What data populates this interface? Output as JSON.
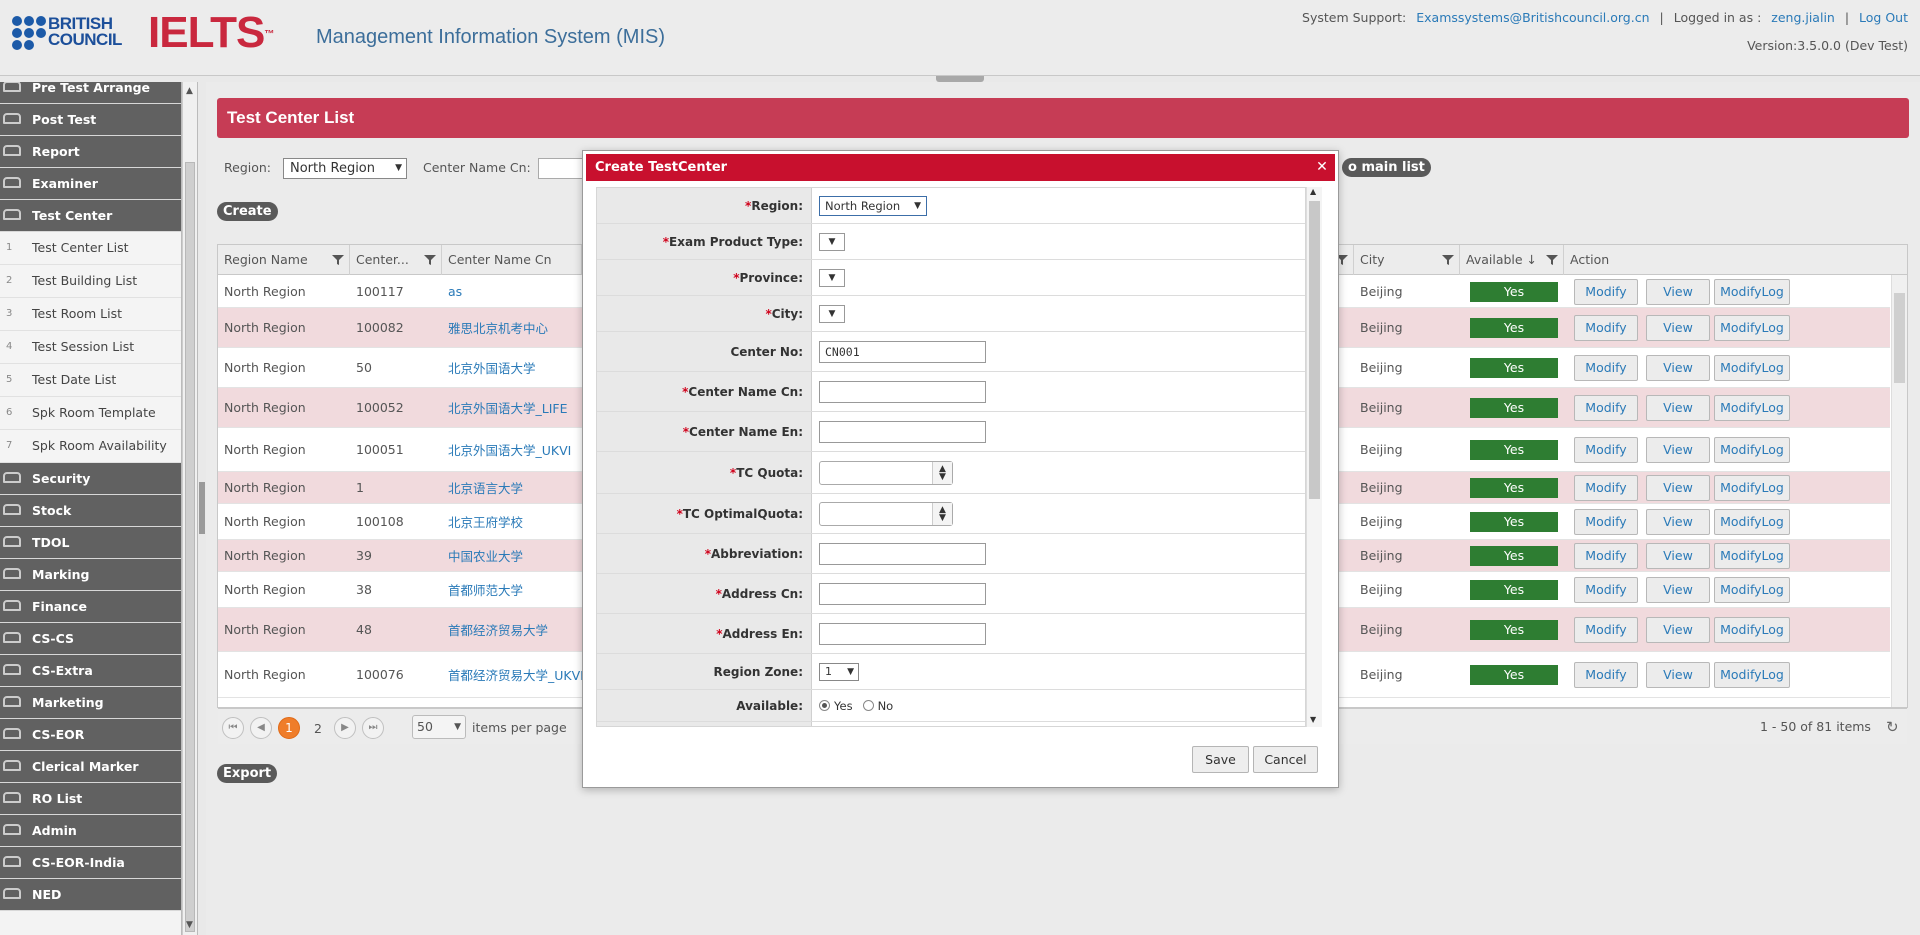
{
  "header": {
    "bc_text_line1": "BRITISH",
    "bc_text_line2": "COUNCIL",
    "ielts_logo": "IELTS",
    "app_title": "Management Information System (MIS)",
    "support_label": "System Support:",
    "support_email": "Examssystems@Britishcouncil.org.cn",
    "logged_label": "Logged in as :",
    "user": "zeng.jialin",
    "logout": "Log Out",
    "version": "Version:3.5.0.0 (Dev Test)"
  },
  "sidebar": {
    "top_items": [
      "Pre Test Arrange",
      "Post Test",
      "Report",
      "Examiner",
      "Test Center"
    ],
    "sub_items": [
      {
        "num": "1",
        "label": "Test Center List"
      },
      {
        "num": "2",
        "label": "Test Building List"
      },
      {
        "num": "3",
        "label": "Test Room List"
      },
      {
        "num": "4",
        "label": "Test Session List"
      },
      {
        "num": "5",
        "label": "Test Date List"
      },
      {
        "num": "6",
        "label": "Spk Room Template"
      },
      {
        "num": "7",
        "label": "Spk Room Availability"
      }
    ],
    "bottom_items": [
      "Security",
      "Stock",
      "TDOL",
      "Marking",
      "Finance",
      "CS-CS",
      "CS-Extra",
      "Marketing",
      "CS-EOR",
      "Clerical Marker",
      "RO List",
      "Admin",
      "CS-EOR-India",
      "NED"
    ]
  },
  "page": {
    "title": "Test Center List",
    "region_label": "Region:",
    "region_value": "North Region",
    "center_name_label": "Center Name Cn:",
    "main_list_btn": "o main list",
    "create_btn": "Create",
    "export_btn": "Export"
  },
  "grid": {
    "headers": {
      "region": "Region Name",
      "center": "Center...",
      "name_cn": "Center Name Cn",
      "city": "City",
      "available": "Available ↓",
      "action": "Action"
    },
    "rows": [
      {
        "region": "North Region",
        "center": "100117",
        "name": "as",
        "city": "Beijing",
        "available": "Yes"
      },
      {
        "region": "North Region",
        "center": "100082",
        "name": "雅思北京机考中心",
        "city": "Beijing",
        "available": "Yes"
      },
      {
        "region": "North Region",
        "center": "50",
        "name": "北京外国语大学",
        "city": "Beijing",
        "available": "Yes"
      },
      {
        "region": "North Region",
        "center": "100052",
        "name": "北京外国语大学_LIFE",
        "city": "Beijing",
        "available": "Yes"
      },
      {
        "region": "North Region",
        "center": "100051",
        "name": "北京外国语大学_UKVI",
        "city": "Beijing",
        "available": "Yes"
      },
      {
        "region": "North Region",
        "center": "1",
        "name": "北京语言大学",
        "city": "Beijing",
        "available": "Yes"
      },
      {
        "region": "North Region",
        "center": "100108",
        "name": "北京王府学校",
        "city": "Beijing",
        "available": "Yes"
      },
      {
        "region": "North Region",
        "center": "39",
        "name": "中国农业大学",
        "city": "Beijing",
        "available": "Yes"
      },
      {
        "region": "North Region",
        "center": "38",
        "name": "首都师范大学",
        "city": "Beijing",
        "available": "Yes"
      },
      {
        "region": "North Region",
        "center": "48",
        "name": "首都经济贸易大学",
        "city": "Beijing",
        "available": "Yes"
      },
      {
        "region": "North Region",
        "center": "100076",
        "name": "首都经济贸易大学_UKVI",
        "city": "Beijing",
        "available": "Yes"
      }
    ],
    "actions": {
      "modify": "Modify",
      "view": "View",
      "log": "ModifyLog"
    },
    "pager": {
      "current": "1",
      "next_page": "2",
      "per_page": "50",
      "per_page_label": "items per page",
      "summary": "1 - 50 of 81 items"
    }
  },
  "modal": {
    "title": "Create TestCenter",
    "fields": {
      "region": {
        "label": "Region:",
        "value": "North Region"
      },
      "exam_product_type": {
        "label": "Exam Product Type:"
      },
      "province": {
        "label": "Province:"
      },
      "city": {
        "label": "City:"
      },
      "center_no": {
        "label": "Center No:",
        "value": "CN001"
      },
      "center_name_cn": {
        "label": "Center Name Cn:",
        "value": ""
      },
      "center_name_en": {
        "label": "Center Name En:",
        "value": ""
      },
      "tc_quota": {
        "label": "TC Quota:"
      },
      "tc_optimal_quota": {
        "label": "TC OptimalQuota:"
      },
      "abbreviation": {
        "label": "Abbreviation:",
        "value": ""
      },
      "address_cn": {
        "label": "Address Cn:",
        "value": ""
      },
      "address_en": {
        "label": "Address En:",
        "value": ""
      },
      "region_zone": {
        "label": "Region Zone:",
        "value": "1"
      },
      "available": {
        "label": "Available:",
        "yes": "Yes",
        "no": "No"
      }
    },
    "save": "Save",
    "cancel": "Cancel"
  },
  "colors": {
    "brand_red": "#c8102e",
    "title_bar": "#c63c55",
    "sidebar_dark": "#616161",
    "yes_green": "#2e7d32",
    "link_blue": "#2a7ab8"
  }
}
